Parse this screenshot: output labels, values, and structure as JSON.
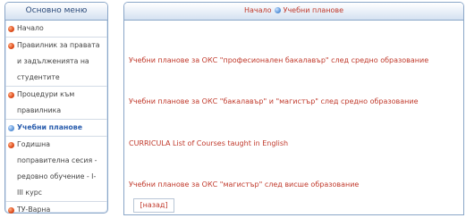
{
  "sidebar": {
    "title": "Основно меню",
    "items": [
      {
        "label": "Начало"
      },
      {
        "label": "Правилник за правата"
      },
      {
        "label": "и задълженията на"
      },
      {
        "label": "студентите"
      },
      {
        "label": "Процедури към"
      },
      {
        "label": "правилника"
      },
      {
        "label": "Учебни планове"
      },
      {
        "label": "Годишна"
      },
      {
        "label": "поправителна сесия -"
      },
      {
        "label": "редовно обучение - I-"
      },
      {
        "label": "III курс"
      },
      {
        "label": "ТУ-Варна"
      }
    ]
  },
  "breadcrumb": {
    "home": "Начало",
    "current": "Учебни планове"
  },
  "main": {
    "links": [
      "Учебни планове за ОКС \"професионален бакалавър\" след средно образование",
      "Учебни планове за ОКС \"бакалавър\" и \"магистър\" след средно образование",
      "CURRICULA List of Courses taught in English",
      "Учебни планове за ОКС \"магистър\" след висше образование"
    ],
    "back_label": "[назад]"
  },
  "colors": {
    "link_red": "#c0392b",
    "active_blue": "#2a5dad",
    "border_blue": "#8aa6c8"
  }
}
